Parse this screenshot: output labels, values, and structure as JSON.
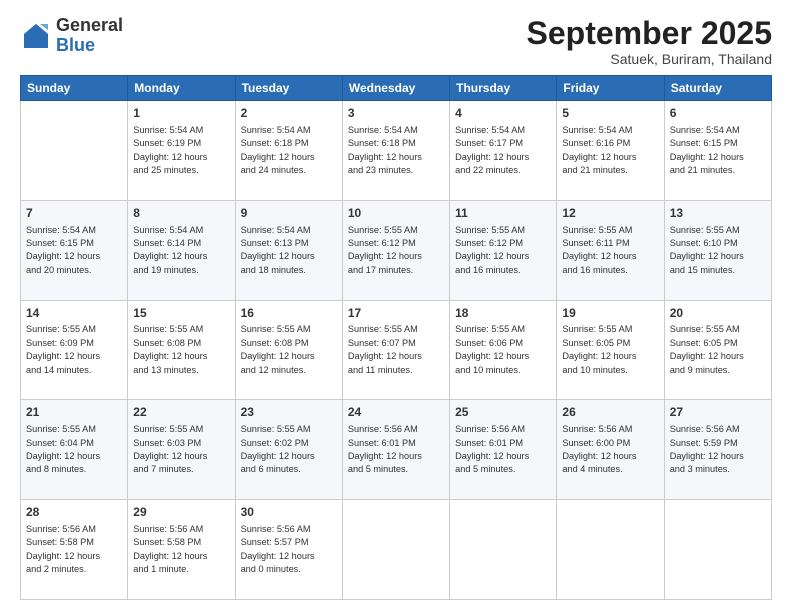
{
  "logo": {
    "general": "General",
    "blue": "Blue"
  },
  "header": {
    "month": "September 2025",
    "location": "Satuek, Buriram, Thailand"
  },
  "weekdays": [
    "Sunday",
    "Monday",
    "Tuesday",
    "Wednesday",
    "Thursday",
    "Friday",
    "Saturday"
  ],
  "weeks": [
    [
      {
        "day": "",
        "content": ""
      },
      {
        "day": "1",
        "content": "Sunrise: 5:54 AM\nSunset: 6:19 PM\nDaylight: 12 hours\nand 25 minutes."
      },
      {
        "day": "2",
        "content": "Sunrise: 5:54 AM\nSunset: 6:18 PM\nDaylight: 12 hours\nand 24 minutes."
      },
      {
        "day": "3",
        "content": "Sunrise: 5:54 AM\nSunset: 6:18 PM\nDaylight: 12 hours\nand 23 minutes."
      },
      {
        "day": "4",
        "content": "Sunrise: 5:54 AM\nSunset: 6:17 PM\nDaylight: 12 hours\nand 22 minutes."
      },
      {
        "day": "5",
        "content": "Sunrise: 5:54 AM\nSunset: 6:16 PM\nDaylight: 12 hours\nand 21 minutes."
      },
      {
        "day": "6",
        "content": "Sunrise: 5:54 AM\nSunset: 6:15 PM\nDaylight: 12 hours\nand 21 minutes."
      }
    ],
    [
      {
        "day": "7",
        "content": "Sunrise: 5:54 AM\nSunset: 6:15 PM\nDaylight: 12 hours\nand 20 minutes."
      },
      {
        "day": "8",
        "content": "Sunrise: 5:54 AM\nSunset: 6:14 PM\nDaylight: 12 hours\nand 19 minutes."
      },
      {
        "day": "9",
        "content": "Sunrise: 5:54 AM\nSunset: 6:13 PM\nDaylight: 12 hours\nand 18 minutes."
      },
      {
        "day": "10",
        "content": "Sunrise: 5:55 AM\nSunset: 6:12 PM\nDaylight: 12 hours\nand 17 minutes."
      },
      {
        "day": "11",
        "content": "Sunrise: 5:55 AM\nSunset: 6:12 PM\nDaylight: 12 hours\nand 16 minutes."
      },
      {
        "day": "12",
        "content": "Sunrise: 5:55 AM\nSunset: 6:11 PM\nDaylight: 12 hours\nand 16 minutes."
      },
      {
        "day": "13",
        "content": "Sunrise: 5:55 AM\nSunset: 6:10 PM\nDaylight: 12 hours\nand 15 minutes."
      }
    ],
    [
      {
        "day": "14",
        "content": "Sunrise: 5:55 AM\nSunset: 6:09 PM\nDaylight: 12 hours\nand 14 minutes."
      },
      {
        "day": "15",
        "content": "Sunrise: 5:55 AM\nSunset: 6:08 PM\nDaylight: 12 hours\nand 13 minutes."
      },
      {
        "day": "16",
        "content": "Sunrise: 5:55 AM\nSunset: 6:08 PM\nDaylight: 12 hours\nand 12 minutes."
      },
      {
        "day": "17",
        "content": "Sunrise: 5:55 AM\nSunset: 6:07 PM\nDaylight: 12 hours\nand 11 minutes."
      },
      {
        "day": "18",
        "content": "Sunrise: 5:55 AM\nSunset: 6:06 PM\nDaylight: 12 hours\nand 10 minutes."
      },
      {
        "day": "19",
        "content": "Sunrise: 5:55 AM\nSunset: 6:05 PM\nDaylight: 12 hours\nand 10 minutes."
      },
      {
        "day": "20",
        "content": "Sunrise: 5:55 AM\nSunset: 6:05 PM\nDaylight: 12 hours\nand 9 minutes."
      }
    ],
    [
      {
        "day": "21",
        "content": "Sunrise: 5:55 AM\nSunset: 6:04 PM\nDaylight: 12 hours\nand 8 minutes."
      },
      {
        "day": "22",
        "content": "Sunrise: 5:55 AM\nSunset: 6:03 PM\nDaylight: 12 hours\nand 7 minutes."
      },
      {
        "day": "23",
        "content": "Sunrise: 5:55 AM\nSunset: 6:02 PM\nDaylight: 12 hours\nand 6 minutes."
      },
      {
        "day": "24",
        "content": "Sunrise: 5:56 AM\nSunset: 6:01 PM\nDaylight: 12 hours\nand 5 minutes."
      },
      {
        "day": "25",
        "content": "Sunrise: 5:56 AM\nSunset: 6:01 PM\nDaylight: 12 hours\nand 5 minutes."
      },
      {
        "day": "26",
        "content": "Sunrise: 5:56 AM\nSunset: 6:00 PM\nDaylight: 12 hours\nand 4 minutes."
      },
      {
        "day": "27",
        "content": "Sunrise: 5:56 AM\nSunset: 5:59 PM\nDaylight: 12 hours\nand 3 minutes."
      }
    ],
    [
      {
        "day": "28",
        "content": "Sunrise: 5:56 AM\nSunset: 5:58 PM\nDaylight: 12 hours\nand 2 minutes."
      },
      {
        "day": "29",
        "content": "Sunrise: 5:56 AM\nSunset: 5:58 PM\nDaylight: 12 hours\nand 1 minute."
      },
      {
        "day": "30",
        "content": "Sunrise: 5:56 AM\nSunset: 5:57 PM\nDaylight: 12 hours\nand 0 minutes."
      },
      {
        "day": "",
        "content": ""
      },
      {
        "day": "",
        "content": ""
      },
      {
        "day": "",
        "content": ""
      },
      {
        "day": "",
        "content": ""
      }
    ]
  ]
}
